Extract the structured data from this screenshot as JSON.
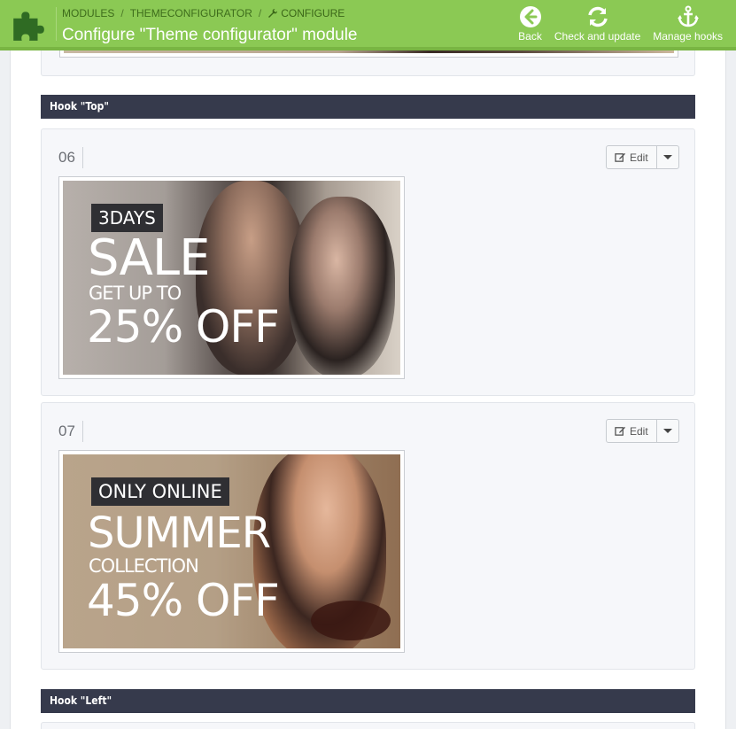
{
  "header": {
    "breadcrumb": [
      "MODULES",
      "THEMECONFIGURATOR",
      "CONFIGURE"
    ],
    "title": "Configure \"Theme configurator\" module",
    "toolbar": {
      "back": "Back",
      "check": "Check and update",
      "hooks": "Manage hooks"
    }
  },
  "hooks": [
    {
      "title": "Hook \"Top\"",
      "items": [
        {
          "number": "06",
          "edit_label": "Edit",
          "banner": {
            "tag": "3DAYS",
            "line1": "SALE",
            "line2": "GET UP TO",
            "line3": "25% OFF"
          }
        },
        {
          "number": "07",
          "edit_label": "Edit",
          "banner": {
            "tag": "ONLY ONLINE",
            "line1": "SUMMER",
            "line2": "COLLECTION",
            "line3": "45% OFF"
          }
        }
      ]
    },
    {
      "title": "Hook \"Left\""
    }
  ],
  "colors": {
    "header_bg": "#8bc954",
    "hook_bar": "#363a4c"
  }
}
